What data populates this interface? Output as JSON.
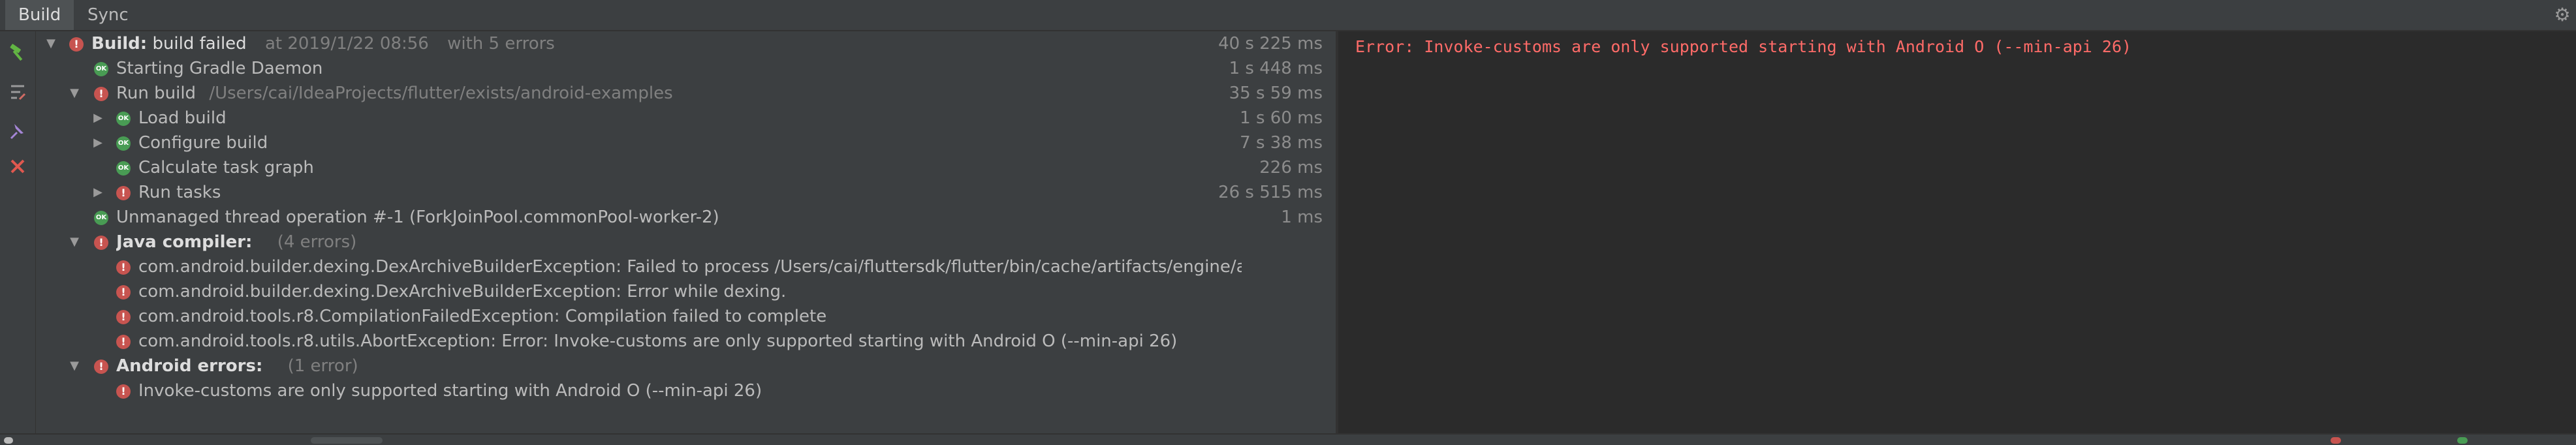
{
  "tabs": {
    "build": "Build",
    "sync": "Sync"
  },
  "icons": {
    "gear": "gear-icon",
    "hammer": "hammer-icon",
    "filter": "filter-icon",
    "pin": "pin-icon",
    "close": "close-icon"
  },
  "tree": {
    "root": {
      "name": "Build:",
      "status": "build failed",
      "at": "at 2019/1/22 08:56",
      "detail": "with 5 errors",
      "time": "40 s 225 ms"
    },
    "daemon": {
      "label": "Starting Gradle Daemon",
      "time": "1 s 448 ms"
    },
    "run_build": {
      "label": "Run build",
      "path": "/Users/cai/IdeaProjects/flutter/exists/android-examples",
      "time": "35 s 59 ms"
    },
    "load_build": {
      "label": "Load build",
      "time": "1 s 60 ms"
    },
    "configure_build": {
      "label": "Configure build",
      "time": "7 s 38 ms"
    },
    "task_graph": {
      "label": "Calculate task graph",
      "time": "226 ms"
    },
    "run_tasks": {
      "label": "Run tasks",
      "time": "26 s 515 ms"
    },
    "unmanaged": {
      "label": "Unmanaged thread operation #-1 (ForkJoinPool.commonPool-worker-2)",
      "time": "1 ms"
    },
    "java_compiler": {
      "label": "Java compiler:",
      "count": "(4 errors)"
    },
    "java_errors": [
      "com.android.builder.dexing.DexArchiveBuilderException: Failed to process /Users/cai/fluttersdk/flutter/bin/cache/artifacts/engine/anc",
      "com.android.builder.dexing.DexArchiveBuilderException: Error while dexing.",
      "com.android.tools.r8.CompilationFailedException: Compilation failed to complete",
      "com.android.tools.r8.utils.AbortException: Error: Invoke-customs are only supported starting with Android O (--min-api 26)"
    ],
    "android_errors": {
      "label": "Android errors:",
      "count": "(1 error)"
    },
    "android_error_items": [
      "Invoke-customs are only supported starting with Android O (--min-api 26)"
    ]
  },
  "console": {
    "text": "Error: Invoke-customs are only supported starting with Android O (--min-api 26)"
  },
  "colors": {
    "error": "#c75450",
    "ok": "#499c54",
    "console_error": "#ff6b68",
    "panel": "#3c3f41",
    "console_bg": "#2b2b2b"
  }
}
